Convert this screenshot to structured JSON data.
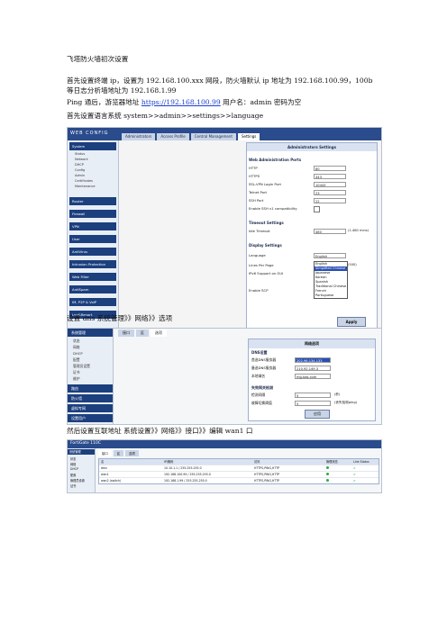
{
  "doc": {
    "title": "飞塔防火墙初次设置",
    "p1": "首先设置终端 ip，设置为 192.168.100.xxx 网段，防火墙默认 ip 地址为 192.168.100.99，100b",
    "p2": "等日志分析墙地址为 192.168.1.99",
    "p3_prefix": "Ping 通后，游览器地址 ",
    "p3_link": "https://192.168.100.99",
    "p3_suffix": "    用户名：admin  密码为空",
    "p4": "首先设置语言系统   system>>admin>>settings>>language",
    "p5": "设置 dns   系统管理》》网络》》选项",
    "p6": "然后设置互联地址   系统设置》》网络》》接口》》编辑 wan1 口"
  },
  "shot1": {
    "logo": "WEB CONFIG",
    "tabs": [
      "Administrators",
      "Access Profile",
      "Central Management",
      "Settings"
    ],
    "nav": {
      "system": "System",
      "system_items": [
        "Status",
        "Network",
        "DHCP",
        "Config",
        "Admin",
        "Certificates",
        "Maintenance"
      ],
      "groups": [
        "Router",
        "Firewall",
        "VPN",
        "User",
        "AntiVirus",
        "Intrusion Protection",
        "Web Filter",
        "AntiSpam",
        "IM, P2P & VoIP",
        "Log&Report"
      ]
    },
    "panel_title": "Administrators Settings",
    "sec_ports": "Web Administration Ports",
    "rows_ports": [
      {
        "label": "HTTP",
        "value": "80"
      },
      {
        "label": "HTTPS",
        "value": "443"
      },
      {
        "label": "SSL-VPN Login Port",
        "value": "10443"
      },
      {
        "label": "Telnet Port",
        "value": "23"
      },
      {
        "label": "SSH Port",
        "value": "22"
      }
    ],
    "ssh_compat": "Enable SSH v1 compatibility",
    "sec_timeout": "Timeout Settings",
    "idle_label": "Idle Timeout",
    "idle_value": "480",
    "idle_unit": "(1-480 mins)",
    "sec_display": "Display Settings",
    "language_label": "Language",
    "language_value": "English",
    "lines_label": "Lines Per Page",
    "lines_unit": "(500)",
    "ipv6_label": "IPv6 Support on GUI",
    "scp_label": "Enable SCP",
    "language_options": [
      "English",
      "Simplified Chinese",
      "Japanese",
      "Korean",
      "Spanish",
      "Traditional Chinese",
      "French",
      "Portuguese"
    ],
    "apply": "Apply"
  },
  "shot2": {
    "tabs": [
      "接口",
      "区",
      "选项"
    ],
    "nav": {
      "system": "系统管理",
      "items": [
        "状态",
        "网络",
        "DHCP",
        "配置",
        "管理员设置",
        "证书",
        "维护"
      ],
      "groups": [
        "路由",
        "防火墙",
        "虚拟专网",
        "设置用户"
      ]
    },
    "panel_title": "网络选项",
    "sec_dns": "DNS设置",
    "rows_dns": [
      {
        "label": "首选DNS服务器",
        "value": "202.96.134.133"
      },
      {
        "label": "备选DNS服务器",
        "value": "210.92.149.3"
      },
      {
        "label": "本地域名",
        "value": "mg-bas.com"
      }
    ],
    "sec_gw": "失效网关检测",
    "rows_gw": [
      {
        "label": "检测间隔",
        "value": "5",
        "extra": "(秒)"
      },
      {
        "label": "故障切换阈值",
        "value": "5",
        "extra": "(丢失检测ping)"
      }
    ],
    "apply": "应用"
  },
  "shot3": {
    "title": "FortiGate 110C",
    "tabs": [
      "接口",
      "区",
      "选项"
    ],
    "nav_group": "系统管理",
    "nav_items": [
      "状态",
      "网络",
      "DHCP",
      "配置",
      "管理员设置",
      "证书"
    ],
    "headers": [
      "名",
      "IP/掩码",
      "访问",
      "管理状态",
      "Link Status"
    ],
    "rows": [
      {
        "name": "dmz",
        "ip": "10.10.1.1 / 255.255.255.0",
        "access": "HTTPS,PING,HTTP"
      },
      {
        "name": "wan1",
        "ip": "192.168.100.99 / 255.255.255.0",
        "access": "HTTPS,PING,HTTP"
      },
      {
        "name": "wan2 (switch)",
        "ip": "192.168.1.99 / 255.255.255.0",
        "access": "HTTPS,PING,HTTP"
      }
    ]
  }
}
